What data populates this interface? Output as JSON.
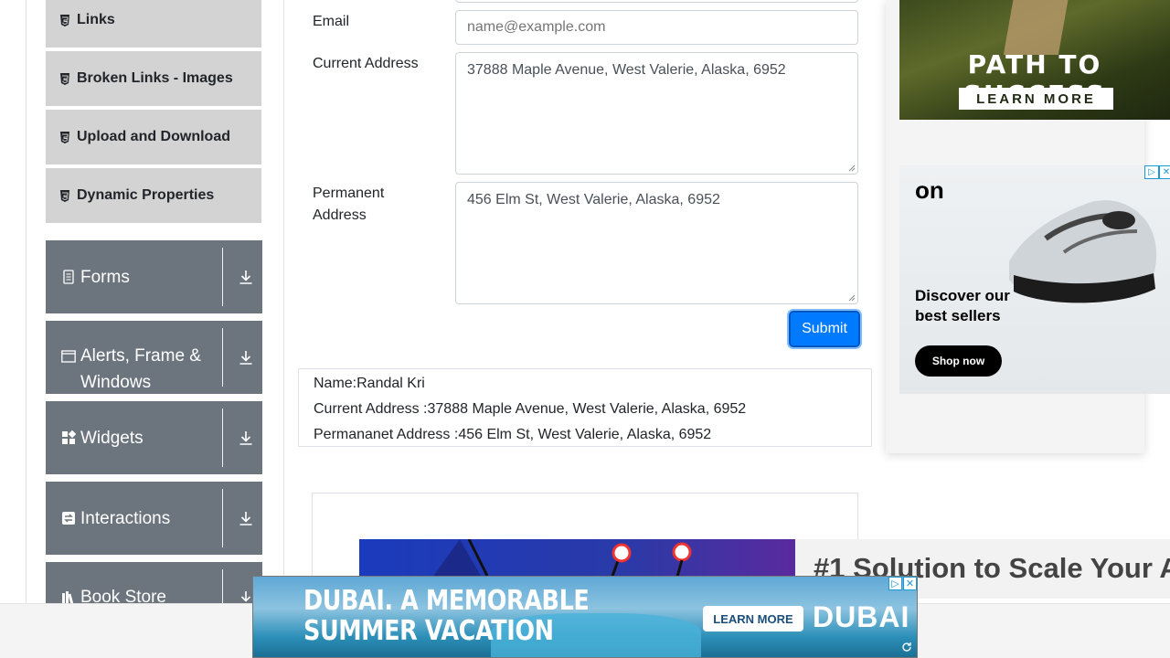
{
  "sidebar": {
    "subitems": [
      {
        "label": "Links",
        "icon": "html5-icon"
      },
      {
        "label": "Broken Links - Images",
        "icon": "html5-icon"
      },
      {
        "label": "Upload and Download",
        "icon": "html5-icon"
      },
      {
        "label": "Dynamic Properties",
        "icon": "html5-icon"
      }
    ],
    "groups": [
      {
        "label": "Forms",
        "icon": "form-icon"
      },
      {
        "label": "Alerts, Frame & Windows",
        "icon": "window-icon"
      },
      {
        "label": "Widgets",
        "icon": "widgets-icon"
      },
      {
        "label": "Interactions",
        "icon": "interactions-icon"
      },
      {
        "label": "Book Store",
        "icon": "books-icon"
      }
    ]
  },
  "form": {
    "email_label": "Email",
    "email_placeholder": "name@example.com",
    "current_address_label": "Current Address",
    "current_address_value": "37888 Maple Avenue, West Valerie, Alaska, 6952",
    "permanent_address_label_1": "Permanent",
    "permanent_address_label_2": "Address",
    "permanent_address_value": "456 Elm St, West Valerie, Alaska, 6952",
    "submit_label": "Submit"
  },
  "output": {
    "name": "Name:Randal Kri",
    "current_address": "Current Address :37888 Maple Avenue, West Valerie, Alaska, 6952",
    "permanent_address": "Permananet Address :456 Elm St, West Valerie, Alaska, 6952"
  },
  "ads": {
    "ad1_title": "PATH TO SUCCESS",
    "ad1_cta": "LEARN MORE",
    "ad2_logo": "on",
    "ad2_head_1": "Discover our",
    "ad2_head_2": "best sellers",
    "ad2_cta": "Shop now",
    "mid_text": "#1 Solution to Scale Your A",
    "bottom_head_1": "DUBAI. A MEMORABLE",
    "bottom_head_2": "SUMMER VACATION",
    "bottom_cta": "LEARN MORE",
    "bottom_brand": "DUBAI"
  },
  "colors": {
    "accent": "#007bff",
    "sidebar_group": "#6c757d",
    "sidebar_subitem": "#d3d3d3"
  }
}
